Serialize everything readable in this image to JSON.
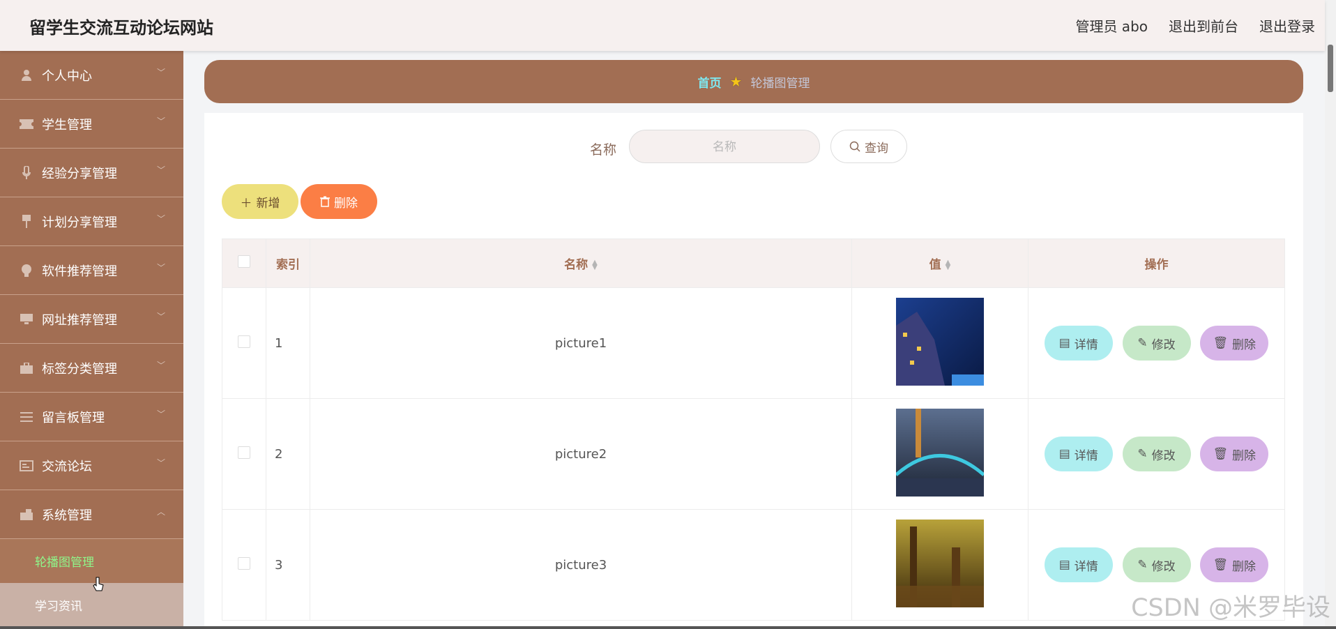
{
  "header": {
    "app_title": "留学生交流互动论坛网站",
    "user_label": "管理员 abo",
    "back_to_front": "退出到前台",
    "logout": "退出登录"
  },
  "sidebar": {
    "items": [
      {
        "label": "个人中心",
        "icon": "person-icon"
      },
      {
        "label": "学生管理",
        "icon": "ticket-icon"
      },
      {
        "label": "经验分享管理",
        "icon": "microphone-icon"
      },
      {
        "label": "计划分享管理",
        "icon": "pin-icon"
      },
      {
        "label": "软件推荐管理",
        "icon": "bulb-icon"
      },
      {
        "label": "网址推荐管理",
        "icon": "monitor-icon"
      },
      {
        "label": "标签分类管理",
        "icon": "briefcase-icon"
      },
      {
        "label": "留言板管理",
        "icon": "list-icon"
      },
      {
        "label": "交流论坛",
        "icon": "card-icon"
      },
      {
        "label": "系统管理",
        "icon": "toolbox-icon"
      }
    ],
    "sub_items": [
      {
        "label": "轮播图管理",
        "active": true
      },
      {
        "label": "学习资讯",
        "active": false
      }
    ]
  },
  "breadcrumb": {
    "home": "首页",
    "current": "轮播图管理"
  },
  "search": {
    "label": "名称",
    "placeholder": "名称",
    "button": "查询"
  },
  "actions": {
    "add": "新增",
    "delete": "删除"
  },
  "table": {
    "columns": {
      "index": "索引",
      "name": "名称",
      "value": "值",
      "ops": "操作"
    },
    "rows": [
      {
        "index": "1",
        "name": "picture1"
      },
      {
        "index": "2",
        "name": "picture2"
      },
      {
        "index": "3",
        "name": "picture3"
      }
    ],
    "row_buttons": {
      "detail": "详情",
      "edit": "修改",
      "delete": "删除"
    }
  },
  "watermark": "CSDN @米罗毕设",
  "colors": {
    "primary": "#a26e53",
    "breadcrumb_home": "#7ee7ef",
    "active_submenu": "#8ff68a",
    "add_button": "#ede07c",
    "delete_button": "#fb7e45",
    "detail_button": "#aeeef0",
    "edit_button": "#c6e8c8",
    "row_delete_button": "#d7b4e8"
  }
}
